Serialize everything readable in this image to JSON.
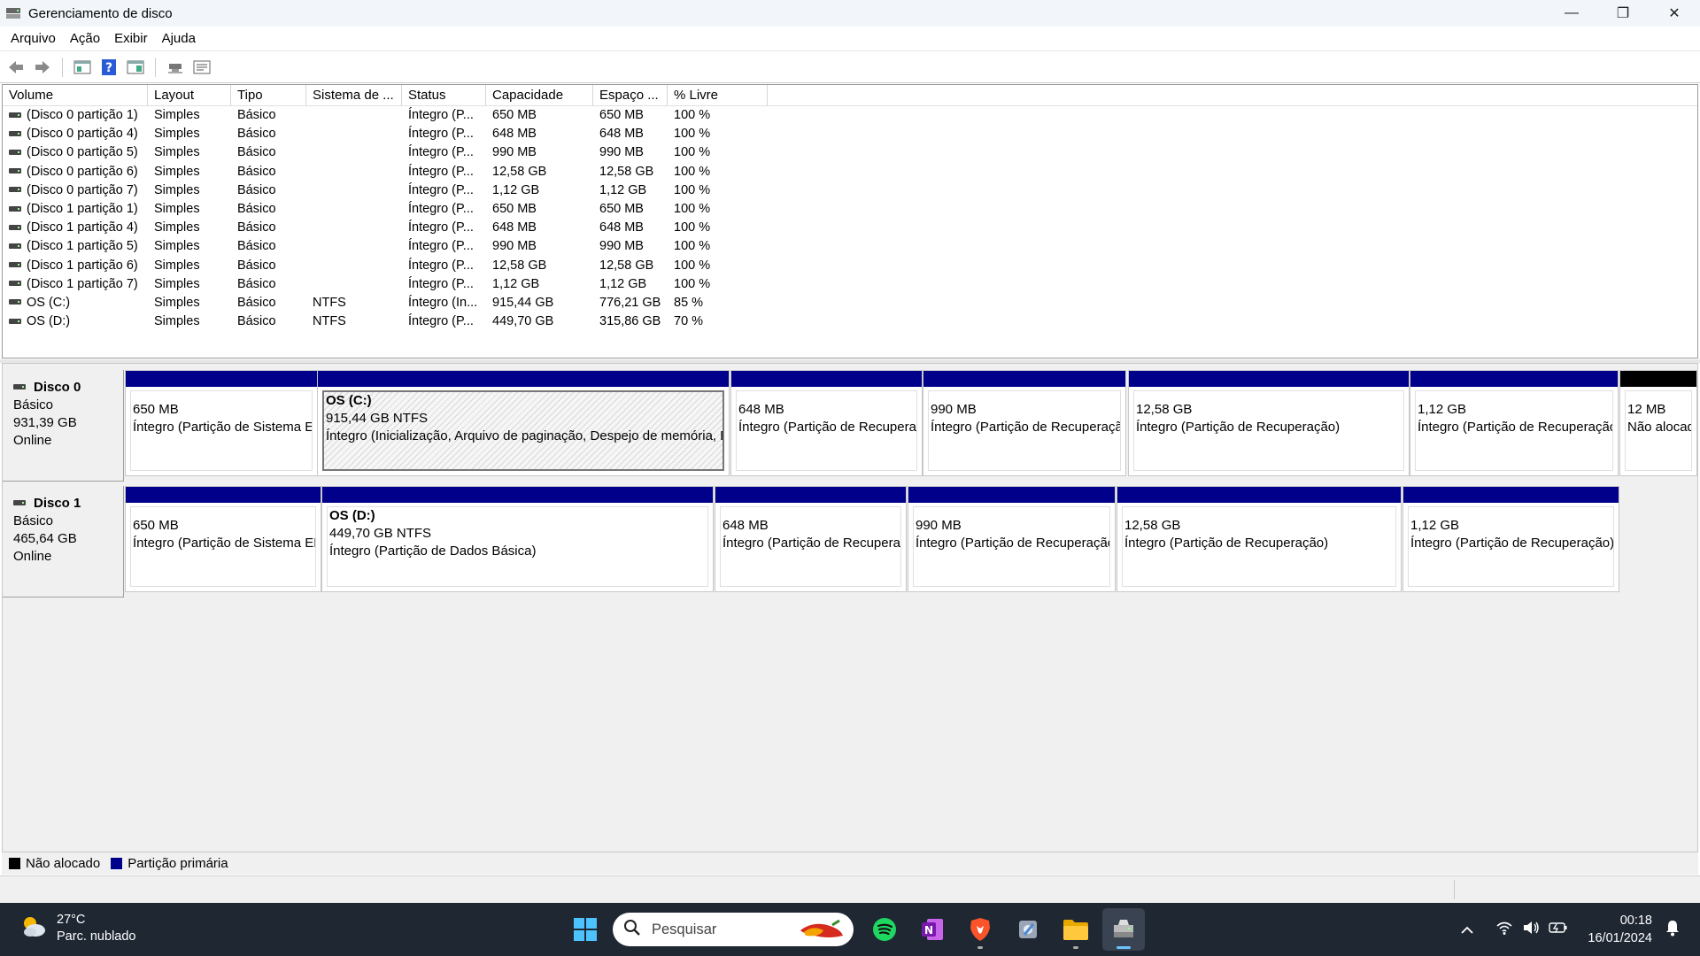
{
  "window": {
    "title": "Gerenciamento de disco",
    "controls": {
      "minimize": "—",
      "restore": "❐",
      "close": "✕"
    }
  },
  "menu": [
    "Arquivo",
    "Ação",
    "Exibir",
    "Ajuda"
  ],
  "toolbar": {
    "icons": [
      "back-arrow-icon",
      "forward-arrow-icon",
      "properties-icon",
      "help-icon",
      "view-icon",
      "rescan-icon",
      "settings-icon"
    ]
  },
  "volume_list": {
    "columns": [
      "Volume",
      "Layout",
      "Tipo",
      "Sistema de ...",
      "Status",
      "Capacidade",
      "Espaço ...",
      "% Livre"
    ],
    "rows": [
      [
        "(Disco 0 partição 1)",
        "Simples",
        "Básico",
        "",
        "Íntegro (P...",
        "650 MB",
        "650 MB",
        "100 %"
      ],
      [
        "(Disco 0 partição 4)",
        "Simples",
        "Básico",
        "",
        "Íntegro (P...",
        "648 MB",
        "648 MB",
        "100 %"
      ],
      [
        "(Disco 0 partição 5)",
        "Simples",
        "Básico",
        "",
        "Íntegro (P...",
        "990 MB",
        "990 MB",
        "100 %"
      ],
      [
        "(Disco 0 partição 6)",
        "Simples",
        "Básico",
        "",
        "Íntegro (P...",
        "12,58 GB",
        "12,58 GB",
        "100 %"
      ],
      [
        "(Disco 0 partição 7)",
        "Simples",
        "Básico",
        "",
        "Íntegro (P...",
        "1,12 GB",
        "1,12 GB",
        "100 %"
      ],
      [
        "(Disco 1 partição 1)",
        "Simples",
        "Básico",
        "",
        "Íntegro (P...",
        "650 MB",
        "650 MB",
        "100 %"
      ],
      [
        "(Disco 1 partição 4)",
        "Simples",
        "Básico",
        "",
        "Íntegro (P...",
        "648 MB",
        "648 MB",
        "100 %"
      ],
      [
        "(Disco 1 partição 5)",
        "Simples",
        "Básico",
        "",
        "Íntegro (P...",
        "990 MB",
        "990 MB",
        "100 %"
      ],
      [
        "(Disco 1 partição 6)",
        "Simples",
        "Básico",
        "",
        "Íntegro (P...",
        "12,58 GB",
        "12,58 GB",
        "100 %"
      ],
      [
        "(Disco 1 partição 7)",
        "Simples",
        "Básico",
        "",
        "Íntegro (P...",
        "1,12 GB",
        "1,12 GB",
        "100 %"
      ],
      [
        "OS (C:)",
        "Simples",
        "Básico",
        "NTFS",
        "Íntegro (In...",
        "915,44 GB",
        "776,21 GB",
        "85 %"
      ],
      [
        "OS (D:)",
        "Simples",
        "Básico",
        "NTFS",
        "Íntegro (P...",
        "449,70 GB",
        "315,86 GB",
        "70 %"
      ]
    ]
  },
  "disks": [
    {
      "name": "Disco 0",
      "type": "Básico",
      "size": "931,39 GB",
      "status": "Online",
      "partitions": [
        {
          "label": "",
          "size": "650 MB",
          "status": "Íntegro (Partição de Sistema EFI)"
        },
        {
          "label": "OS  (C:)",
          "size": "915,44 GB NTFS",
          "status": "Íntegro (Inicialização, Arquivo de paginação, Despejo de memória, Partição de Dados Básica)"
        },
        {
          "label": "",
          "size": "648 MB",
          "status": "Íntegro (Partição de Recuperação)"
        },
        {
          "label": "",
          "size": "990 MB",
          "status": "Íntegro (Partição de Recuperação)"
        },
        {
          "label": "",
          "size": "12,58 GB",
          "status": "Íntegro (Partição de Recuperação)"
        },
        {
          "label": "",
          "size": "1,12 GB",
          "status": "Íntegro (Partição de Recuperação)"
        },
        {
          "label": "",
          "size": "12 MB",
          "status": "Não alocado"
        }
      ]
    },
    {
      "name": "Disco 1",
      "type": "Básico",
      "size": "465,64 GB",
      "status": "Online",
      "partitions": [
        {
          "label": "",
          "size": "650 MB",
          "status": "Íntegro (Partição de Sistema EFI)"
        },
        {
          "label": "OS  (D:)",
          "size": "449,70 GB NTFS",
          "status": "Íntegro (Partição de Dados Básica)"
        },
        {
          "label": "",
          "size": "648 MB",
          "status": "Íntegro (Partição de Recuperação)"
        },
        {
          "label": "",
          "size": "990 MB",
          "status": "Íntegro (Partição de Recuperação)"
        },
        {
          "label": "",
          "size": "12,58 GB",
          "status": "Íntegro (Partição de Recuperação)"
        },
        {
          "label": "",
          "size": "1,12 GB",
          "status": "Íntegro (Partição de Recuperação)"
        }
      ]
    }
  ],
  "legend": [
    {
      "label": "Não alocado",
      "color": "#000000"
    },
    {
      "label": "Partição primária",
      "color": "#00008b"
    }
  ],
  "taskbar": {
    "weather": {
      "temp": "27°C",
      "desc": "Parc. nublado"
    },
    "search_placeholder": "Pesquisar",
    "apps": [
      "windows-start-icon",
      "spotify-icon",
      "onenote-icon",
      "brave-icon",
      "tool-icon",
      "file-explorer-icon",
      "disk-management-icon"
    ],
    "clock": {
      "time": "00:18",
      "date": "16/01/2024"
    }
  },
  "colors": {
    "primary_partition": "#00008b",
    "unallocated": "#000000",
    "taskbar": "#1f2733"
  }
}
